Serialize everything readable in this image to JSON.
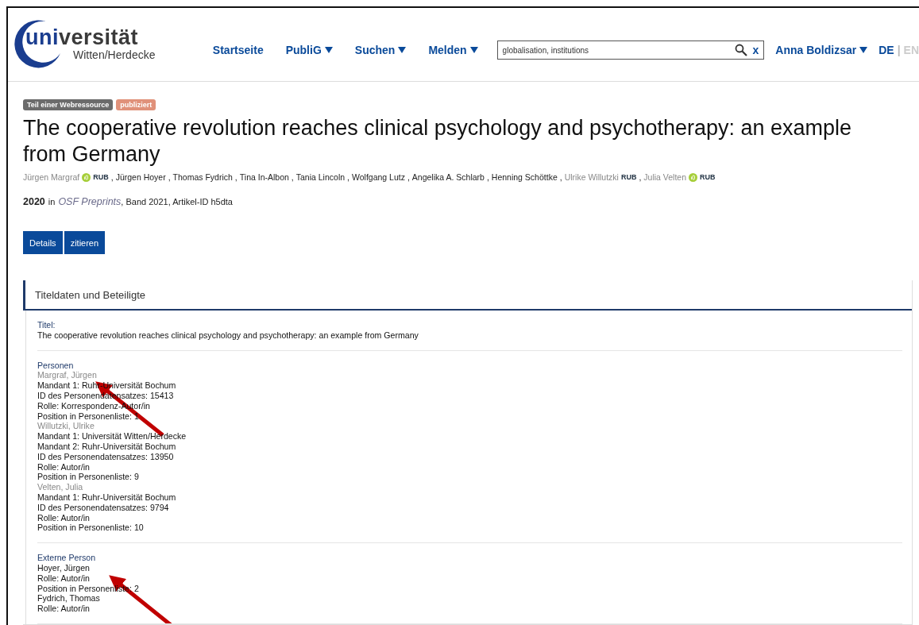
{
  "header": {
    "logo": {
      "prefix": "uni",
      "main": "versität",
      "sub": "Witten/Herdecke"
    },
    "nav": [
      {
        "label": "Startseite",
        "has_menu": false
      },
      {
        "label": "PubliG",
        "has_menu": true
      },
      {
        "label": "Suchen",
        "has_menu": true
      },
      {
        "label": "Melden",
        "has_menu": true
      }
    ],
    "search": {
      "value": "globalisation, institutions",
      "clear": "x"
    },
    "user": {
      "label": "Anna Boldizsar",
      "has_menu": true
    },
    "language_separator": "|",
    "languages": [
      {
        "label": "DE",
        "selected": true
      },
      {
        "label": "EN",
        "selected": false
      }
    ]
  },
  "badges": [
    {
      "label": "Teil einer Webressource",
      "color": "#6b6b6b"
    },
    {
      "label": "publiziert",
      "color": "#e0917a"
    }
  ],
  "title": "The cooperative revolution reaches clinical psychology and psychotherapy: an example from Germany",
  "author_separator": ",",
  "authors": [
    {
      "name": "Jürgen Margraf",
      "internal": true,
      "orcid": true,
      "rub": "RUB"
    },
    {
      "name": "Jürgen Hoyer",
      "internal": false,
      "orcid": false
    },
    {
      "name": "Thomas Fydrich",
      "internal": false,
      "orcid": false
    },
    {
      "name": "Tina In-Albon",
      "internal": false,
      "orcid": false
    },
    {
      "name": "Tania Lincoln",
      "internal": false,
      "orcid": false
    },
    {
      "name": "Wolfgang Lutz",
      "internal": false,
      "orcid": false
    },
    {
      "name": "Angelika A. Schlarb",
      "internal": false,
      "orcid": false
    },
    {
      "name": "Henning Schöttke",
      "internal": false,
      "orcid": false
    },
    {
      "name": "Ulrike Willutzki",
      "internal": true,
      "orcid": false,
      "rub": "RUB"
    },
    {
      "name": "Julia Velten",
      "internal": true,
      "orcid": true,
      "rub": "RUB"
    }
  ],
  "publication": {
    "year": "2020",
    "in": "in",
    "journal": "OSF Preprints",
    "rest": ", Band 2021, Artikel-ID h5dta"
  },
  "buttons": [
    "Details",
    "zitieren"
  ],
  "section": {
    "title": "Titeldaten und Beteiligte",
    "blocks": [
      {
        "label": "Titel:",
        "entries": [
          {
            "kind": "line",
            "text": "The cooperative revolution reaches clinical psychology and psychotherapy: an example from Germany"
          }
        ]
      },
      {
        "label": "Personen",
        "entries": [
          {
            "kind": "name",
            "text": "Margraf, Jürgen"
          },
          {
            "kind": "line",
            "text": "Mandant 1: Ruhr-Universität Bochum"
          },
          {
            "kind": "line",
            "text": "ID des Personendatensatzes: 15413"
          },
          {
            "kind": "line",
            "text": "Rolle: Korrespondenz-Autor/in"
          },
          {
            "kind": "line",
            "text": "Position in Personenliste: 1"
          },
          {
            "kind": "name",
            "text": "Willutzki, Ulrike"
          },
          {
            "kind": "line",
            "text": "Mandant 1: Universität Witten/Herdecke"
          },
          {
            "kind": "line",
            "text": "Mandant 2: Ruhr-Universität Bochum"
          },
          {
            "kind": "line",
            "text": "ID des Personendatensatzes: 13950"
          },
          {
            "kind": "line",
            "text": "Rolle: Autor/in"
          },
          {
            "kind": "line",
            "text": "Position in Personenliste: 9"
          },
          {
            "kind": "name",
            "text": "Velten, Julia"
          },
          {
            "kind": "line",
            "text": "Mandant 1: Ruhr-Universität Bochum"
          },
          {
            "kind": "line",
            "text": "ID des Personendatensatzes: 9794"
          },
          {
            "kind": "line",
            "text": "Rolle: Autor/in"
          },
          {
            "kind": "line",
            "text": "Position in Personenliste: 10"
          }
        ]
      },
      {
        "label": "Externe Person",
        "entries": [
          {
            "kind": "line",
            "text": "Hoyer, Jürgen"
          },
          {
            "kind": "line",
            "text": "Rolle: Autor/in"
          },
          {
            "kind": "line",
            "text": "Position in Personenliste: 2"
          },
          {
            "kind": "line",
            "text": "Fydrich, Thomas"
          },
          {
            "kind": "line",
            "text": "Rolle: Autor/in"
          }
        ]
      }
    ]
  }
}
